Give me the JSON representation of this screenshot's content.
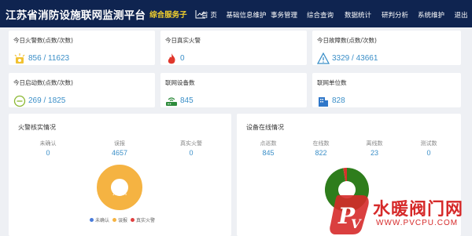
{
  "header": {
    "title": "江苏省消防设施联网监测平台",
    "subtitle": "综合服务子",
    "nav": [
      "首 页",
      "基础信息维护",
      "事务管理",
      "综合查询",
      "数据统计",
      "研判分析",
      "系统维护",
      "退出"
    ]
  },
  "cards": [
    {
      "title": "今日火警数(点数/次数)",
      "value": "856 / 11623",
      "icon": "fire-alarm-icon"
    },
    {
      "title": "今日真实火警",
      "value": "0",
      "icon": "flame-icon"
    },
    {
      "title": "今日故障数(点数/次数)",
      "value": "3329 / 43661",
      "icon": "warning-triangle-icon"
    },
    {
      "title": "今日启动数(点数/次数)",
      "value": "269 / 1825",
      "icon": "minus-circle-icon"
    },
    {
      "title": "联网设备数",
      "value": "845",
      "icon": "router-icon"
    },
    {
      "title": "联网单位数",
      "value": "828",
      "icon": "building-icon"
    }
  ],
  "fire_panel": {
    "title": "火警核实情况",
    "metrics": [
      {
        "label": "未确认",
        "value": "0"
      },
      {
        "label": "误报",
        "value": "4657"
      },
      {
        "label": "真实火警",
        "value": "0"
      }
    ],
    "pie_label": "100.0%",
    "legend": [
      "未确认",
      "误报",
      "真实火警"
    ],
    "colors": {
      "unconfirmed": "#4a7cdb",
      "false_alarm": "#f5b342",
      "real_fire": "#e04040"
    }
  },
  "device_panel": {
    "title": "设备在线情况",
    "metrics": [
      {
        "label": "点巡数",
        "value": "845"
      },
      {
        "label": "在线数",
        "value": "822"
      },
      {
        "label": "离线数",
        "value": "23"
      },
      {
        "label": "测试数",
        "value": "0"
      }
    ],
    "colors": {
      "online": "#2e7d1c",
      "offline": "#d8322b"
    }
  },
  "chart_data": [
    {
      "type": "pie",
      "categories": [
        "未确认",
        "误报",
        "真实火警"
      ],
      "values": [
        0,
        4657,
        0
      ]
    },
    {
      "type": "pie",
      "categories": [
        "在线数",
        "离线数"
      ],
      "values": [
        822,
        23
      ]
    }
  ],
  "watermark": {
    "text": "水暖阀门网",
    "url": "WWW.PVCPU.COM"
  }
}
